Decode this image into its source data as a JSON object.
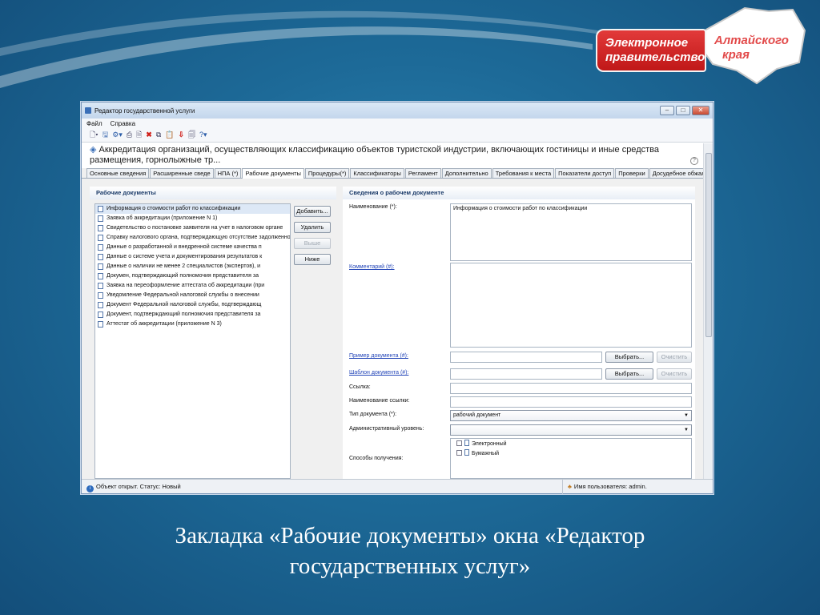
{
  "logo": {
    "line1": "Электронное",
    "line2": "правительство",
    "region1": "Алтайского",
    "region2": "края"
  },
  "window": {
    "title": "Редактор государственной услуги",
    "controls": {
      "minimize": "–",
      "maximize": "□",
      "close": "✕"
    }
  },
  "menu": {
    "file": "Файл",
    "help": "Справка"
  },
  "toolbar": {
    "icons": [
      "new-icon",
      "save-icon",
      "settings-icon",
      "print-icon",
      "preview-icon",
      "delete-icon",
      "copy-icon",
      "paste-icon",
      "import-icon",
      "export-icon",
      "help-icon"
    ],
    "glyphs": {
      "new": "🗋▾",
      "save": "🖫",
      "settings": "⚙▾",
      "print": "⎙",
      "preview": "🗎",
      "delete": "✖",
      "copy": "⧉",
      "paste": "📋",
      "import": "⇩",
      "export": "🗐",
      "help": "?▾"
    }
  },
  "header": {
    "text": "Аккредитация организаций, осуществляющих классификацию объектов туристской индустрии, включающих гостиницы и иные средства размещения, горнолыжные тр...",
    "help": "?"
  },
  "tabs": [
    "Основные сведения",
    "Расширенные сведе",
    "НПА (*)",
    "Рабочие документы",
    "Процедуры(*)",
    "Классификаторы",
    "Регламент",
    "Дополнительно",
    "Требования к места",
    "Показатели доступ",
    "Проверки",
    "Досудебное обжало"
  ],
  "active_tab": 3,
  "left": {
    "heading": "Рабочие документы",
    "documents": [
      "Информация о стоимости работ по классификации",
      "Заявка об аккредитации (приложение N 1)",
      "Свидетельство о постановке заявителя на учет в налоговом органе",
      "Справку налогового органа, подтверждающую отсутствие задолженности",
      "Данные о разработанной и внедренной системе качества п",
      "Данные о системе учета и документирования результатов к",
      "Данные о наличии не менее 2 специалистов (экспертов), и",
      "Докумен, подтверждающий полномочия представителя за",
      "Заявка на переоформление аттестата об аккредитации (при",
      " Уведомление Федеральной налоговой службы о внесении",
      " Документ Федеральной налоговой службы, подтверждающ",
      "Документ, подтверждающий полномочия представителя за",
      "Аттестат об аккредитации (приложение N 3)"
    ],
    "selected_index": 0,
    "buttons": {
      "add": "Добавить...",
      "delete": "Удалить",
      "up": "Выше",
      "down": "Ниже"
    }
  },
  "right": {
    "heading": "Сведения о рабочем документе",
    "name_label": "Наименование (*):",
    "name_value": "Информация о стоимости работ по классификации",
    "comment_label": "Комментарий (#):",
    "comment_value": "",
    "example_label": "Пример документа (#):",
    "template_label": "Шаблон документа (#):",
    "choose": "Выбрать...",
    "clear": "Очистить",
    "link_label": "Ссылка:",
    "link_name_label": "Наименование ссылки:",
    "doc_type_label": "Тип документа (*):",
    "doc_type_value": "рабочий документ",
    "admin_level_label": "Административный уровень:",
    "admin_level_value": "",
    "ways_label": "Способы получения:",
    "ways": [
      "Электронный",
      "Бумажный"
    ]
  },
  "status": {
    "text": "Объект открыт. Статус: Новый",
    "user": "Имя пользователя: admin."
  },
  "caption": {
    "line1": "Закладка «Рабочие документы» окна «Редактор",
    "line2": "государственных услуг»"
  }
}
